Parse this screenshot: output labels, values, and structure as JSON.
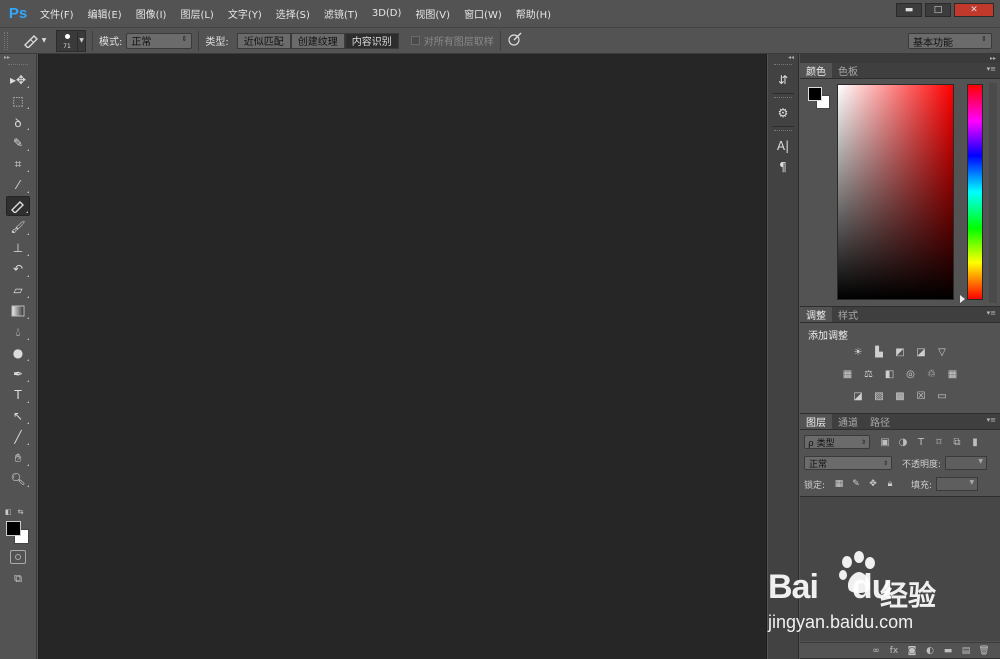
{
  "app": {
    "logo": "Ps"
  },
  "menu": [
    "文件(F)",
    "编辑(E)",
    "图像(I)",
    "图层(L)",
    "文字(Y)",
    "选择(S)",
    "滤镜(T)",
    "3D(D)",
    "视图(V)",
    "窗口(W)",
    "帮助(H)"
  ],
  "window_controls": {
    "minimize": "▬",
    "maximize": "□",
    "close": "✕"
  },
  "options": {
    "brush_size": "71",
    "mode_label": "模式:",
    "mode_value": "正常",
    "type_label": "类型:",
    "type_options": [
      "近似匹配",
      "创建纹理",
      "内容识别"
    ],
    "type_selected": "内容识别",
    "sample_all_layers": "对所有图层取样",
    "workspace": "基本功能"
  },
  "tools": [
    "move-tool",
    "marquee-tool",
    "lasso-tool",
    "quick-select-tool",
    "crop-tool",
    "eyedropper-tool",
    "spot-healing-tool",
    "brush-tool",
    "clone-stamp-tool",
    "history-brush-tool",
    "eraser-tool",
    "gradient-tool",
    "blur-tool",
    "dodge-tool",
    "pen-tool",
    "type-tool",
    "path-select-tool",
    "line-tool",
    "hand-tool",
    "zoom-tool"
  ],
  "active_tool": "spot-healing-tool",
  "color_panel": {
    "tabs": [
      "颜色",
      "色板"
    ],
    "foreground": "#000000",
    "background": "#ffffff",
    "hue": "#ff0000"
  },
  "adjust_panel": {
    "tabs": [
      "调整",
      "样式"
    ],
    "title": "添加调整"
  },
  "layers_panel": {
    "tabs": [
      "图层",
      "通道",
      "路径"
    ],
    "filter": "ρ 类型",
    "blend": "正常",
    "opacity_label": "不透明度:",
    "lock_label": "锁定:",
    "fill_label": "填充:"
  },
  "watermark": {
    "logo": "Bai",
    "logo2": "du",
    "cn": "经验",
    "url": "jingyan.baidu.com"
  },
  "colors": {
    "accent": "#31a8ff",
    "canvas": "#262626",
    "chrome": "#535353"
  }
}
